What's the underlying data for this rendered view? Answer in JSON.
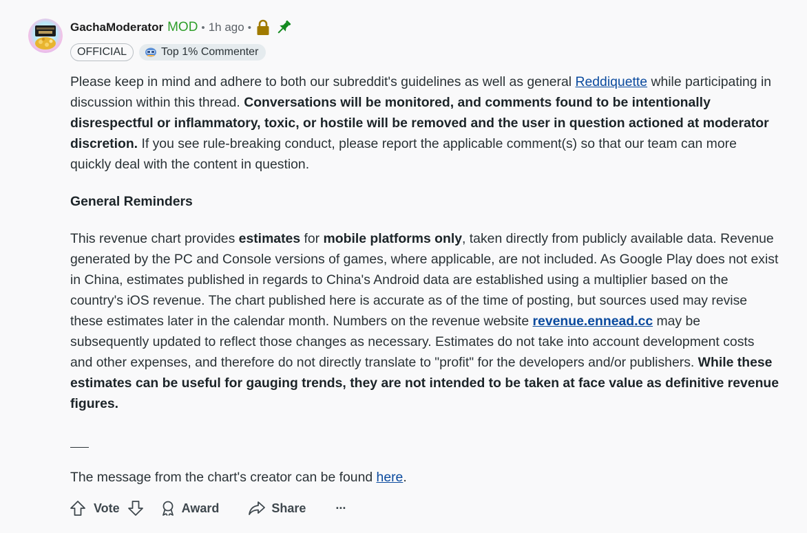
{
  "comment": {
    "author": "GachaModerator",
    "mod_tag": "MOD",
    "separator": "•",
    "time": "1h ago",
    "flairs": {
      "official": "OFFICIAL",
      "commenter": "Top 1% Commenter"
    },
    "p1": {
      "t1": "Please keep in mind and adhere to both our subreddit's guidelines as well as general ",
      "link": "Reddiquette",
      "t2": " while participating in discussion within this thread. ",
      "bold": "Conversations will be monitored, and comments found to be intentionally disrespectful or inflammatory, toxic, or hostile will be removed and the user in question actioned at moderator discretion.",
      "t3": " If you see rule-breaking conduct, please report the applicable comment(s) so that our team can more quickly deal with the content in question."
    },
    "heading": "General Reminders",
    "p3": {
      "t1": "This revenue chart provides ",
      "b1": "estimates",
      "t2": " for ",
      "b2": "mobile platforms only",
      "t3": ", taken directly from publicly available data. Revenue generated by the PC and Console versions of games, where applicable, are not included. As Google Play does not exist in China, estimates published in regards to China's Android data are established using a multiplier based on the country's iOS revenue. The chart published here is accurate as of the time of posting, but sources used may revise these estimates later in the calendar month. Numbers on the revenue website ",
      "link": "revenue.ennead.cc",
      "t4": " may be subsequently updated to reflect those changes as necessary. Estimates do not take into account development costs and other expenses, and therefore do not directly translate to \"profit\" for the developers and/or publishers. ",
      "b3": "While these estimates can be useful for gauging trends, they are not intended to be taken at face value as definitive revenue figures."
    },
    "footer": {
      "t1": "The message from the chart's creator can be found ",
      "link": "here",
      "t2": "."
    }
  },
  "actions": {
    "vote_label": "Vote",
    "award_label": "Award",
    "share_label": "Share",
    "more_label": "···"
  },
  "colors": {
    "mod_green": "#2e9e2a",
    "lock_gold": "#a07a00",
    "pin_green": "#138a1f",
    "link_blue": "#0a4a9e",
    "background": "#f9f9fa"
  },
  "icons": [
    "lock-icon",
    "pin-icon",
    "upvote-icon",
    "downvote-icon",
    "award-icon",
    "share-icon",
    "more-icon",
    "commenter-icon"
  ]
}
